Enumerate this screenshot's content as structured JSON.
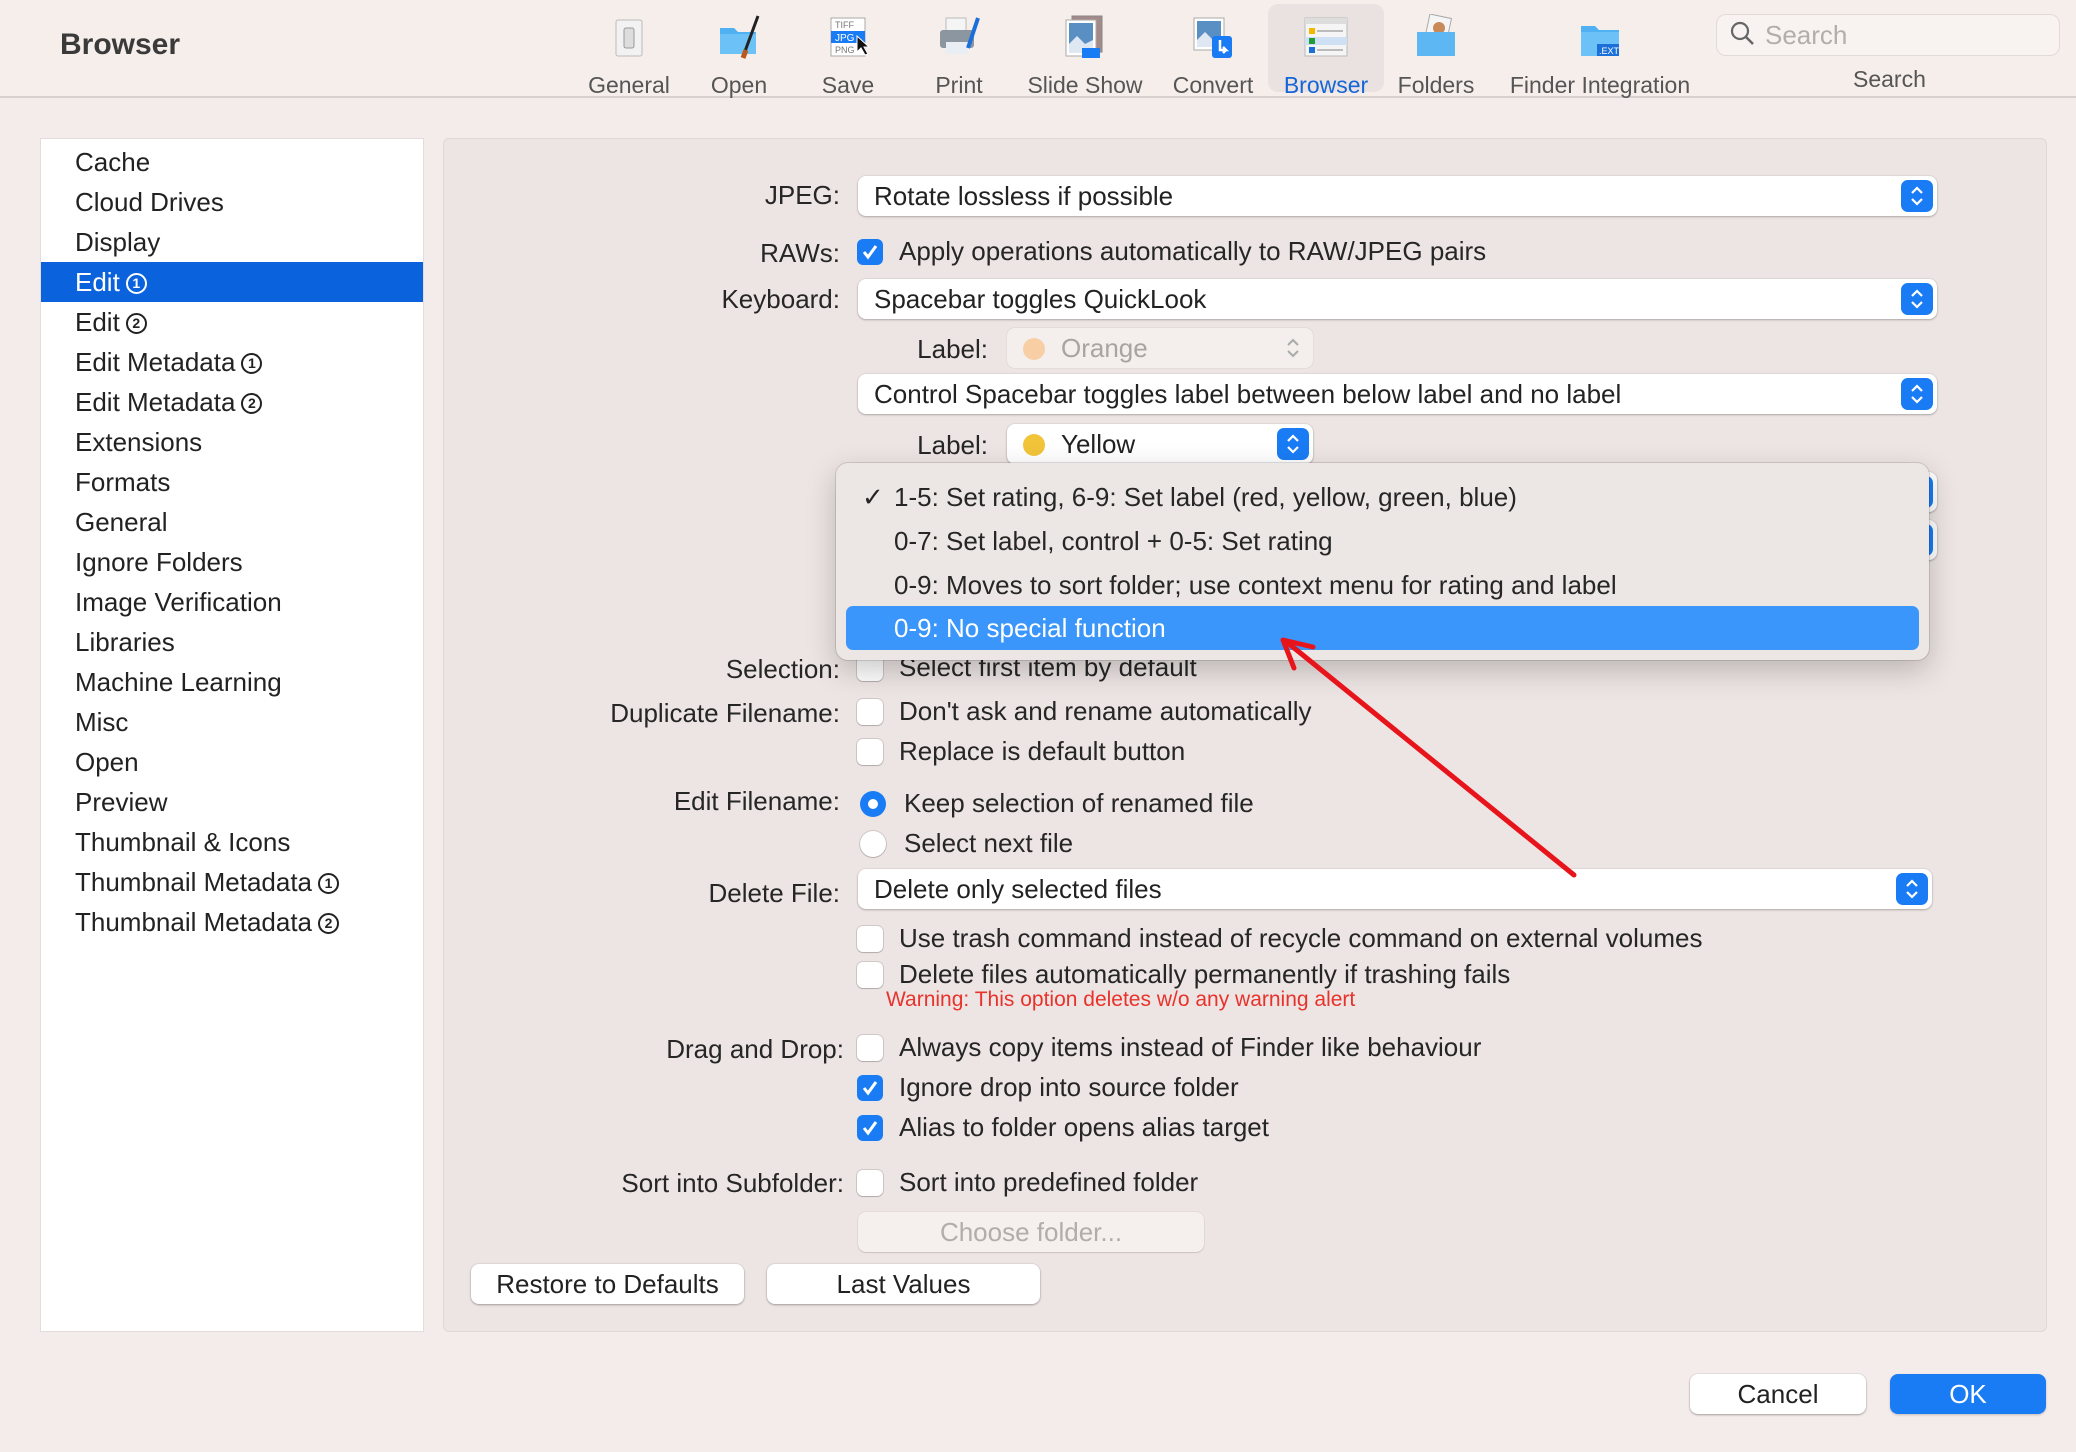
{
  "window": {
    "title": "Browser"
  },
  "toolbar": {
    "items": [
      {
        "label": "General",
        "icon": "switch-icon"
      },
      {
        "label": "Open",
        "icon": "folder-brush-icon"
      },
      {
        "label": "Save",
        "icon": "file-formats-icon",
        "formats": [
          "TIFF",
          "JPG",
          "PNG"
        ]
      },
      {
        "label": "Print",
        "icon": "printer-icon"
      },
      {
        "label": "Slide Show",
        "icon": "slideshow-icon"
      },
      {
        "label": "Convert",
        "icon": "convert-icon"
      },
      {
        "label": "Browser",
        "icon": "browser-list-icon",
        "active": true
      },
      {
        "label": "Folders",
        "icon": "folder-person-icon"
      },
      {
        "label": "Finder Integration",
        "icon": "folder-ext-icon",
        "badge": ".EXT"
      }
    ],
    "search": {
      "placeholder": "Search",
      "caption": "Search",
      "value": ""
    }
  },
  "sidebar": {
    "items": [
      {
        "label": "Cache",
        "badge": ""
      },
      {
        "label": "Cloud Drives",
        "badge": ""
      },
      {
        "label": "Display",
        "badge": ""
      },
      {
        "label": "Edit",
        "badge": "1",
        "selected": true
      },
      {
        "label": "Edit",
        "badge": "2"
      },
      {
        "label": "Edit Metadata",
        "badge": "1"
      },
      {
        "label": "Edit Metadata",
        "badge": "2"
      },
      {
        "label": "Extensions",
        "badge": ""
      },
      {
        "label": "Formats",
        "badge": ""
      },
      {
        "label": "General",
        "badge": ""
      },
      {
        "label": "Ignore Folders",
        "badge": ""
      },
      {
        "label": "Image Verification",
        "badge": ""
      },
      {
        "label": "Libraries",
        "badge": ""
      },
      {
        "label": "Machine Learning",
        "badge": ""
      },
      {
        "label": "Misc",
        "badge": ""
      },
      {
        "label": "Open",
        "badge": ""
      },
      {
        "label": "Preview",
        "badge": ""
      },
      {
        "label": "Thumbnail & Icons",
        "badge": ""
      },
      {
        "label": "Thumbnail Metadata",
        "badge": "1"
      },
      {
        "label": "Thumbnail Metadata",
        "badge": "2"
      }
    ]
  },
  "form": {
    "jpeg": {
      "label": "JPEG:",
      "value": "Rotate lossless if possible"
    },
    "raws": {
      "label": "RAWs:",
      "text": "Apply operations automatically to RAW/JPEG pairs",
      "checked": true
    },
    "keyboard": {
      "label": "Keyboard:",
      "value": "Spacebar toggles QuickLook"
    },
    "label1": {
      "label": "Label:",
      "value": "Orange",
      "color": "#f8cfa4",
      "disabled": true
    },
    "control_spacebar": {
      "value": "Control Spacebar toggles label between below label and no label"
    },
    "label2": {
      "label": "Label:",
      "value": "Yellow",
      "color": "#f2c43a"
    },
    "selection": {
      "label": "Selection:",
      "text": "Select first item by default",
      "checked": false
    },
    "duplicate": {
      "label": "Duplicate Filename:",
      "options": [
        {
          "text": "Don't ask and rename automatically",
          "checked": false
        },
        {
          "text": "Replace is default button",
          "checked": false
        }
      ]
    },
    "edit_filename": {
      "label": "Edit Filename:",
      "options": [
        {
          "text": "Keep selection of renamed file",
          "selected": true
        },
        {
          "text": "Select next file",
          "selected": false
        }
      ]
    },
    "delete_file": {
      "label": "Delete File:",
      "value": "Delete only selected files",
      "options": [
        {
          "text": "Use trash command instead of recycle command on external volumes",
          "checked": false
        },
        {
          "text": "Delete files automatically permanently if trashing fails",
          "checked": false
        }
      ],
      "warning": "Warning: This option deletes w/o any warning alert"
    },
    "drag_drop": {
      "label": "Drag  and Drop:",
      "options": [
        {
          "text": "Always copy items instead of Finder like behaviour",
          "checked": false
        },
        {
          "text": "Ignore drop into source folder",
          "checked": true
        },
        {
          "text": "Alias to folder opens alias target",
          "checked": true
        }
      ]
    },
    "sort_subfolder": {
      "label": "Sort into Subfolder:",
      "text": "Sort into predefined folder",
      "checked": false,
      "choose_button": "Choose folder..."
    },
    "restore_button": "Restore to Defaults",
    "last_values_button": "Last Values"
  },
  "popup_menu": {
    "items": [
      {
        "text": "1-5: Set rating, 6-9: Set label (red, yellow, green, blue)",
        "checked": true
      },
      {
        "text": "0-7: Set label, control + 0-5: Set rating",
        "checked": false
      },
      {
        "text": "0-9: Moves to sort folder; use context menu for rating and label",
        "checked": false
      },
      {
        "text": "0-9: No special function",
        "checked": false,
        "highlighted": true
      }
    ],
    "checkmark": "✓"
  },
  "dialog": {
    "cancel": "Cancel",
    "ok": "OK"
  },
  "annotation": {
    "arrow_color": "#e8141c"
  },
  "colors": {
    "accent": "#1a7cf5",
    "selection": "#0a63dc",
    "menu_highlight": "#3a96fb",
    "warning": "#e8322b"
  }
}
